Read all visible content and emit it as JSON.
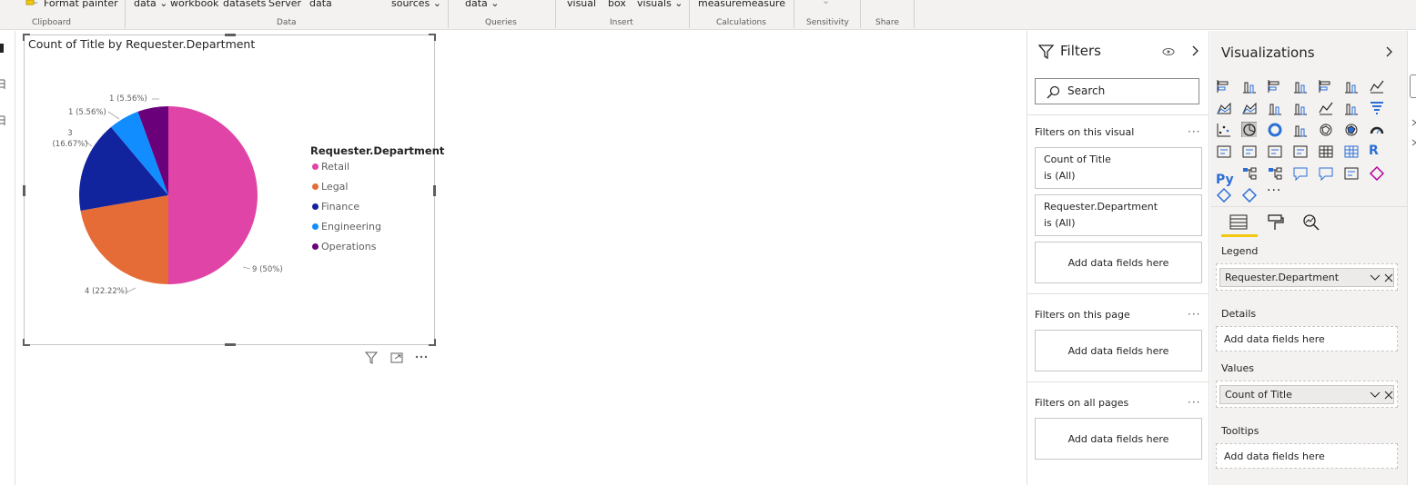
{
  "ribbon": {
    "buttons": [
      "Format painter",
      "data ⌄",
      "workbook",
      "datasets",
      "Server",
      "data",
      "sources ⌄",
      "data ⌄",
      "visual",
      "box",
      "visuals ⌄",
      "measure",
      "measure",
      "⌄"
    ],
    "groups": [
      "Clipboard",
      "Data",
      "Queries",
      "Insert",
      "Calculations",
      "Sensitivity",
      "Share"
    ]
  },
  "visual": {
    "title": "Count of Title by Requester.Department",
    "legend_title": "Requester.Department"
  },
  "chart_data": {
    "type": "pie",
    "title": "Count of Title by Requester.Department",
    "legend_title": "Requester.Department",
    "legend_position": "right",
    "categories": [
      "Retail",
      "Legal",
      "Finance",
      "Engineering",
      "Operations"
    ],
    "values": [
      9,
      4,
      3,
      1,
      1
    ],
    "labels": [
      "9 (50%)",
      "4 (22.22%)",
      "3 (16.67%)",
      "1 (5.56%)",
      "1 (5.56%)"
    ],
    "colors": [
      "#e044a7",
      "#e66c37",
      "#12239e",
      "#118dff",
      "#6b007b"
    ]
  },
  "filters": {
    "title": "Filters",
    "search_placeholder": "Search",
    "on_visual": "Filters on this visual",
    "cards": [
      {
        "name": "Count of Title",
        "state": "is (All)"
      },
      {
        "name": "Requester.Department",
        "state": "is (All)"
      }
    ],
    "add_label": "Add data fields here",
    "on_page": "Filters on this page",
    "on_all_pages": "Filters on all pages",
    "dots": "···"
  },
  "visualizations": {
    "title": "Visualizations",
    "more": "···",
    "legend_label": "Legend",
    "legend_field": "Requester.Department",
    "details_label": "Details",
    "values_label": "Values",
    "values_field": "Count of Title",
    "tooltips_label": "Tooltips",
    "add_label": "Add data fields here",
    "r_icon": "R",
    "py_icon": "Py"
  },
  "colors": {
    "accent": "#f2c811",
    "chart_selected": "#252423"
  }
}
